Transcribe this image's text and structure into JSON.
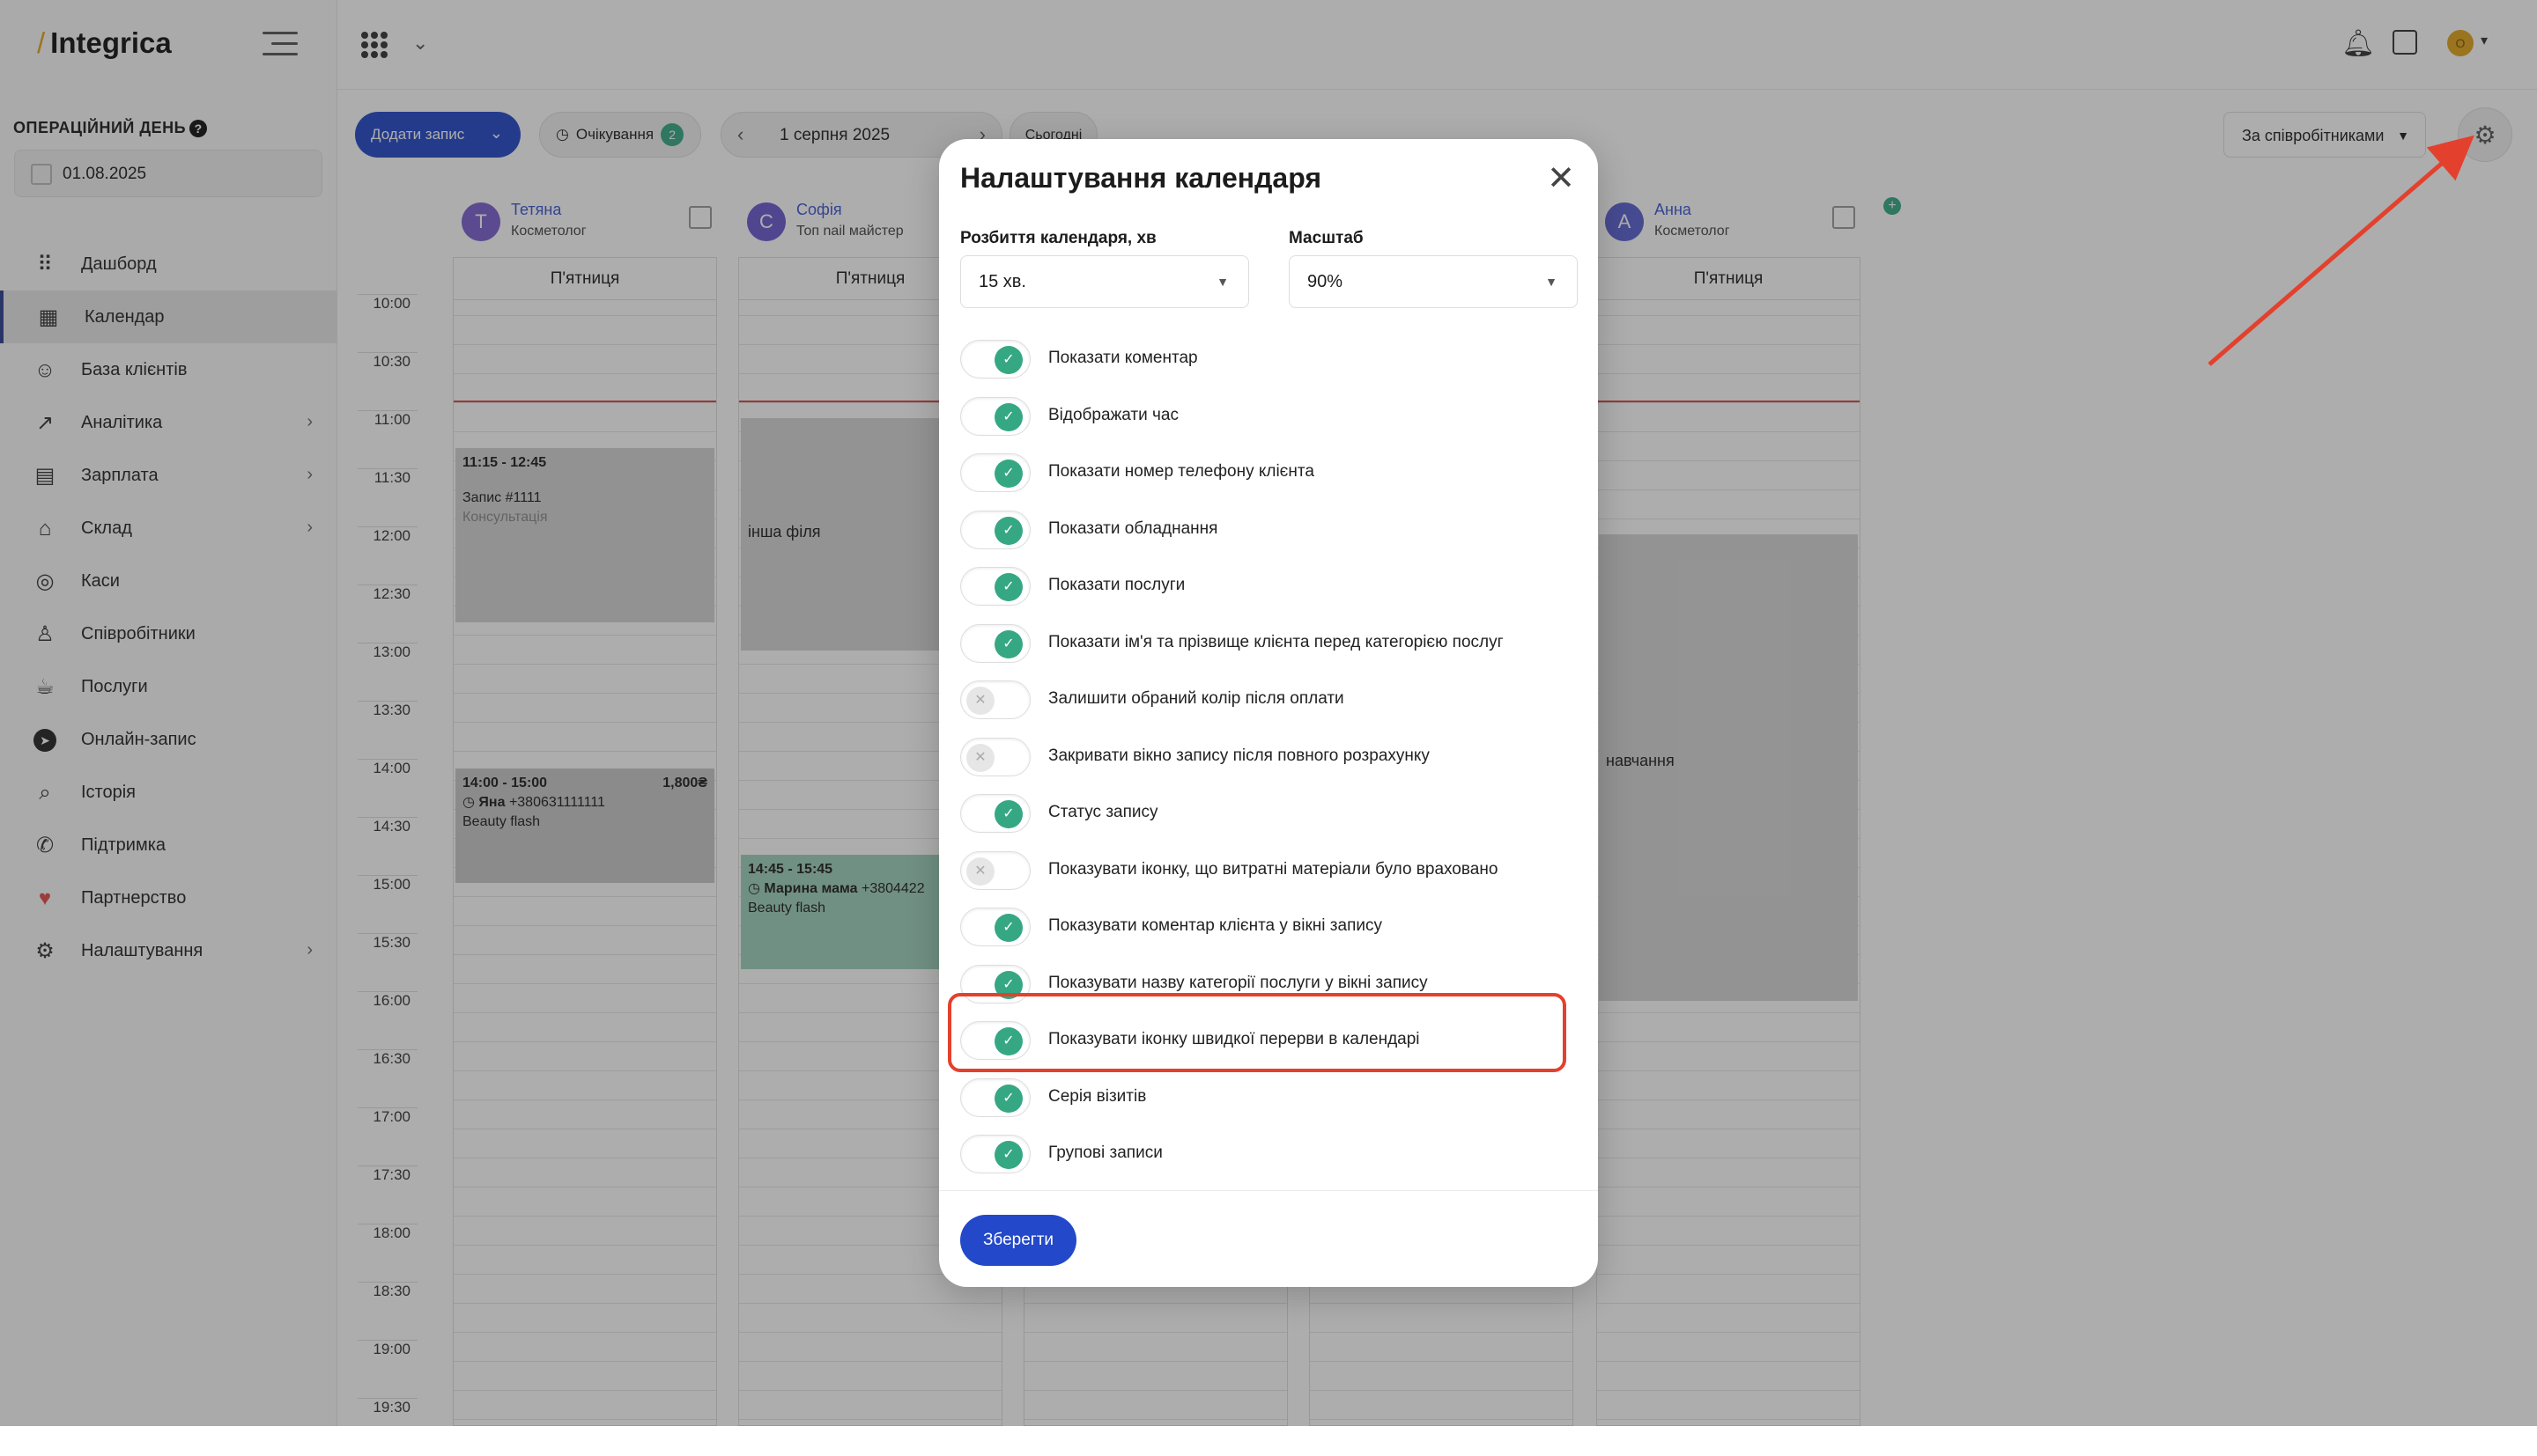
{
  "app": {
    "logo_text": "Integrica"
  },
  "sidebar": {
    "opday_label": "ОПЕРАЦІЙНИЙ ДЕНЬ",
    "opday_date": "01.08.2025",
    "items": [
      {
        "label": "Дашборд",
        "icon": "grid-icon",
        "chevron": false
      },
      {
        "label": "Календар",
        "icon": "calendar-icon",
        "chevron": false,
        "active": true
      },
      {
        "label": "База клієнтів",
        "icon": "user-icon",
        "chevron": false
      },
      {
        "label": "Аналітика",
        "icon": "chart-icon",
        "chevron": true
      },
      {
        "label": "Зарплата",
        "icon": "wallet-icon",
        "chevron": true
      },
      {
        "label": "Склад",
        "icon": "home-icon",
        "chevron": true
      },
      {
        "label": "Каси",
        "icon": "coins-icon",
        "chevron": false
      },
      {
        "label": "Співробітники",
        "icon": "staff-icon",
        "chevron": false
      },
      {
        "label": "Послуги",
        "icon": "coffee-icon",
        "chevron": false
      },
      {
        "label": "Онлайн-запис",
        "icon": "telegram-icon",
        "chevron": false
      },
      {
        "label": "Історія",
        "icon": "search-icon",
        "chevron": false
      },
      {
        "label": "Підтримка",
        "icon": "phone-icon",
        "chevron": false
      },
      {
        "label": "Партнерство",
        "icon": "heart-icon",
        "chevron": false
      },
      {
        "label": "Налаштування",
        "icon": "gear-icon",
        "chevron": true
      }
    ]
  },
  "toolbar": {
    "add_label": "Додати запис",
    "waiting_label": "Очікування",
    "waiting_count": "2",
    "date": "1 серпня 2025",
    "today_label": "Сьогодні",
    "view_select": "За співробітниками"
  },
  "calendar": {
    "day_label": "П'ятниця",
    "times": [
      "10:00",
      "10:30",
      "11:00",
      "11:30",
      "12:00",
      "12:30",
      "13:00",
      "13:30",
      "14:00",
      "14:30",
      "15:00",
      "15:30",
      "16:00",
      "16:30",
      "17:00",
      "17:30",
      "18:00",
      "18:30",
      "19:00",
      "19:30"
    ],
    "staff": [
      {
        "initial": "Т",
        "name": "Тетяна",
        "role": "Косметолог",
        "color": "#7b5fd1"
      },
      {
        "initial": "С",
        "name": "Софія",
        "role": "Топ nail майстер",
        "color": "#6a5ad1"
      },
      {
        "initial": "А",
        "name": "Анна",
        "role": "Косметолог",
        "color": "#5a5fd1"
      }
    ],
    "events": {
      "e1_time": "11:15 - 12:45",
      "e1_title": "Запис #1111",
      "e1_sub": "Консультація",
      "e2_time": "14:00 - 15:00",
      "e2_price": "1,800₴",
      "e2_client": "Яна",
      "e2_phone": "+380631111111",
      "e2_service": "Beauty flash",
      "e3_title": "інша філя",
      "e4_time": "14:45 - 15:45",
      "e4_client": "Марина мама",
      "e4_phone": "+3804422",
      "e4_service": "Beauty flash",
      "e5_title": "навчання"
    }
  },
  "modal": {
    "title": "Налаштування календаря",
    "split_label": "Розбиття календаря, хв",
    "split_value": "15 хв.",
    "scale_label": "Масштаб",
    "scale_value": "90%",
    "options": [
      {
        "label": "Показати коментар",
        "on": true
      },
      {
        "label": "Відображати час",
        "on": true
      },
      {
        "label": "Показати номер телефону клієнта",
        "on": true
      },
      {
        "label": "Показати обладнання",
        "on": true
      },
      {
        "label": "Показати послуги",
        "on": true
      },
      {
        "label": "Показати ім'я та прізвище клієнта перед категорією послуг",
        "on": true
      },
      {
        "label": "Залишити обраний колір після оплати",
        "on": false
      },
      {
        "label": "Закривати вікно запису після повного розрахунку",
        "on": false
      },
      {
        "label": "Статус запису",
        "on": true
      },
      {
        "label": "Показувати іконку, що витратні матеріали було враховано",
        "on": false
      },
      {
        "label": "Показувати коментар клієнта у вікні запису",
        "on": true
      },
      {
        "label": "Показувати назву категорії послуги у вікні запису",
        "on": true
      },
      {
        "label": "Показувати іконку швидкої перерви в календарі",
        "on": true
      },
      {
        "label": "Серія візитів",
        "on": true
      },
      {
        "label": "Групові записи",
        "on": true
      }
    ],
    "save_label": "Зберегти"
  },
  "annotation_color": "#e3412d",
  "accent_color": "#2348c9",
  "toggle_on_color": "#35a883"
}
